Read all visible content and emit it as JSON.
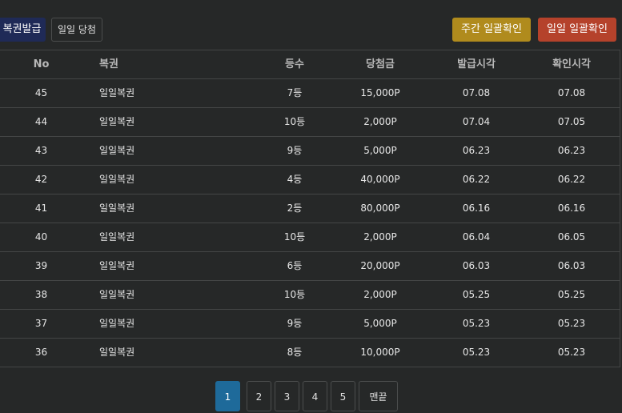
{
  "toolbar": {
    "issue_label": "복권발급",
    "daily_win_label": "일일 당첨",
    "weekly_check_label": "주간 일괄확인",
    "daily_check_label": "일일 일괄확인"
  },
  "table": {
    "headers": {
      "no": "No",
      "name": "복권",
      "rank": "등수",
      "prize": "당첨금",
      "issued": "발급시각",
      "checked": "확인시각"
    },
    "rows": [
      {
        "no": "45",
        "name": "일일복권",
        "rank": "7등",
        "prize": "15,000P",
        "issued": "07.08",
        "checked": "07.08"
      },
      {
        "no": "44",
        "name": "일일복권",
        "rank": "10등",
        "prize": "2,000P",
        "issued": "07.04",
        "checked": "07.05"
      },
      {
        "no": "43",
        "name": "일일복권",
        "rank": "9등",
        "prize": "5,000P",
        "issued": "06.23",
        "checked": "06.23"
      },
      {
        "no": "42",
        "name": "일일복권",
        "rank": "4등",
        "prize": "40,000P",
        "issued": "06.22",
        "checked": "06.22"
      },
      {
        "no": "41",
        "name": "일일복권",
        "rank": "2등",
        "prize": "80,000P",
        "issued": "06.16",
        "checked": "06.16"
      },
      {
        "no": "40",
        "name": "일일복권",
        "rank": "10등",
        "prize": "2,000P",
        "issued": "06.04",
        "checked": "06.05"
      },
      {
        "no": "39",
        "name": "일일복권",
        "rank": "6등",
        "prize": "20,000P",
        "issued": "06.03",
        "checked": "06.03"
      },
      {
        "no": "38",
        "name": "일일복권",
        "rank": "10등",
        "prize": "2,000P",
        "issued": "05.25",
        "checked": "05.25"
      },
      {
        "no": "37",
        "name": "일일복권",
        "rank": "9등",
        "prize": "5,000P",
        "issued": "05.23",
        "checked": "05.23"
      },
      {
        "no": "36",
        "name": "일일복권",
        "rank": "8등",
        "prize": "10,000P",
        "issued": "05.23",
        "checked": "05.23"
      }
    ]
  },
  "pagination": {
    "pages": [
      "1",
      "2",
      "3",
      "4",
      "5"
    ],
    "current": "1",
    "last_label": "맨끝"
  },
  "colors": {
    "background": "#262828",
    "issue_button": "#1f2a57",
    "weekly_button": "#b08b1d",
    "daily_button": "#b5422b",
    "active_page": "#1e6a9a"
  }
}
